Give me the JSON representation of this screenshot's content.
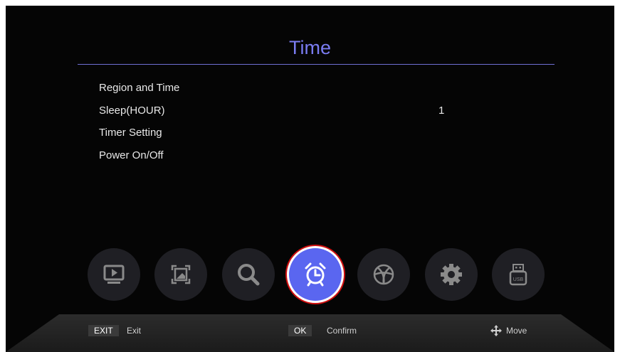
{
  "header": {
    "title": "Time"
  },
  "menu": {
    "items": [
      {
        "label": "Region and Time",
        "value": ""
      },
      {
        "label": "Sleep(HOUR)",
        "value": "1"
      },
      {
        "label": "Timer Setting",
        "value": ""
      },
      {
        "label": "Power On/Off",
        "value": ""
      }
    ]
  },
  "toolbar": {
    "icons": [
      "media-player-icon",
      "picture-icon",
      "search-icon",
      "alarm-clock-icon",
      "internet-icon",
      "gear-icon",
      "usb-icon"
    ],
    "active": "alarm-clock-icon",
    "active_color": "#5A66F0",
    "highlight_ring_color": "#D01010"
  },
  "footer": {
    "exit_key": "EXIT",
    "exit_label": "Exit",
    "ok_key": "OK",
    "ok_label": "Confirm",
    "move_label": "Move"
  },
  "colors": {
    "title": "#7A7CF2",
    "background": "#050505"
  }
}
